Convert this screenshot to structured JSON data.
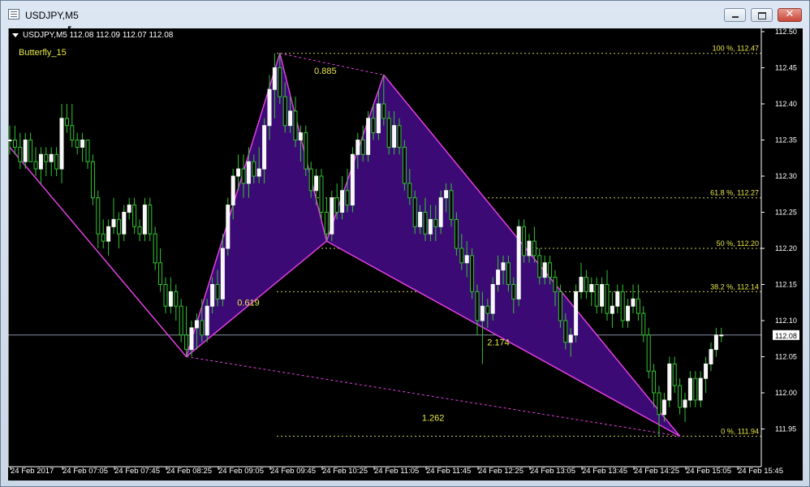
{
  "window": {
    "title": "USDJPY,M5",
    "minimize_label": "",
    "maximize_label": "",
    "close_label": "✕"
  },
  "chart_data": {
    "type": "candlestick",
    "header": "USDJPY,M5  112.08 112.09 112.07 112.08",
    "symbol": "USDJPY,M5",
    "ohlc_header": [
      112.08,
      112.09,
      112.07,
      112.08
    ],
    "indicator_name": "Butterfly_15",
    "current_price": 112.08,
    "current_price_label": "112.08",
    "ylim": [
      111.9,
      112.5
    ],
    "y_ticks": [
      111.95,
      112.0,
      112.05,
      112.1,
      112.15,
      112.2,
      112.25,
      112.3,
      112.35,
      112.4,
      112.45,
      112.5
    ],
    "y_tick_labels": [
      "111.95",
      "112.00",
      "112.05",
      "112.10",
      "112.15",
      "112.20",
      "112.25",
      "112.30",
      "112.35",
      "112.40",
      "112.45",
      "112.50"
    ],
    "x_labels": [
      "24 Feb 2017",
      "24 Feb 07:05",
      "24 Feb 07:45",
      "24 Feb 08:25",
      "24 Feb 09:05",
      "24 Feb 09:45",
      "24 Feb 10:25",
      "24 Feb 11:05",
      "24 Feb 11:45",
      "24 Feb 12:25",
      "24 Feb 13:05",
      "24 Feb 13:45",
      "24 Feb 14:25",
      "24 Feb 15:05",
      "24 Feb 15:45"
    ],
    "pattern": {
      "name": "Butterfly",
      "points": [
        {
          "bar": 0,
          "price": 112.34
        },
        {
          "bar": 34,
          "price": 112.05
        },
        {
          "bar": 52,
          "price": 112.47
        },
        {
          "bar": 61,
          "price": 112.21
        },
        {
          "bar": 72,
          "price": 112.44
        },
        {
          "bar": 129,
          "price": 111.94
        }
      ],
      "ratios": [
        "0.619",
        "0.885",
        "2.174",
        "1.262"
      ]
    },
    "fibonacci": [
      {
        "level": "100 %",
        "price": 112.47,
        "label": "100 %,  112.47"
      },
      {
        "level": "61.8 %",
        "price": 112.27,
        "label": "61.8 %,  112.27"
      },
      {
        "level": "50 %",
        "price": 112.2,
        "label": "50 %,  112.20"
      },
      {
        "level": "38.2 %",
        "price": 112.14,
        "label": "38.2 %,  112.14"
      },
      {
        "level": "0 %",
        "price": 111.94,
        "label": "0 %,  111.94"
      }
    ],
    "candles": [
      [
        112.35,
        112.37,
        112.33,
        112.35
      ],
      [
        112.35,
        112.37,
        112.33,
        112.34
      ],
      [
        112.34,
        112.36,
        112.31,
        112.32
      ],
      [
        112.32,
        112.36,
        112.31,
        112.35
      ],
      [
        112.35,
        112.36,
        112.32,
        112.32
      ],
      [
        112.32,
        112.34,
        112.3,
        112.31
      ],
      [
        112.31,
        112.34,
        112.29,
        112.33
      ],
      [
        112.33,
        112.34,
        112.3,
        112.32
      ],
      [
        112.32,
        112.34,
        112.3,
        112.33
      ],
      [
        112.33,
        112.34,
        112.3,
        112.31
      ],
      [
        112.31,
        112.4,
        112.29,
        112.38
      ],
      [
        112.38,
        112.4,
        112.36,
        112.37
      ],
      [
        112.37,
        112.4,
        112.34,
        112.35
      ],
      [
        112.35,
        112.36,
        112.33,
        112.34
      ],
      [
        112.34,
        112.36,
        112.32,
        112.35
      ],
      [
        112.35,
        112.35,
        112.31,
        112.32
      ],
      [
        112.32,
        112.33,
        112.26,
        112.27
      ],
      [
        112.27,
        112.28,
        112.2,
        112.22
      ],
      [
        112.22,
        112.24,
        112.2,
        112.21
      ],
      [
        112.21,
        112.24,
        112.19,
        112.23
      ],
      [
        112.23,
        112.27,
        112.22,
        112.24
      ],
      [
        112.24,
        112.25,
        112.2,
        112.22
      ],
      [
        112.22,
        112.26,
        112.21,
        112.25
      ],
      [
        112.25,
        112.27,
        112.24,
        112.26
      ],
      [
        112.26,
        112.27,
        112.22,
        112.23
      ],
      [
        112.23,
        112.24,
        112.21,
        112.22
      ],
      [
        112.22,
        112.27,
        112.21,
        112.26
      ],
      [
        112.26,
        112.27,
        112.21,
        112.22
      ],
      [
        112.22,
        112.23,
        112.17,
        112.18
      ],
      [
        112.18,
        112.2,
        112.14,
        112.15
      ],
      [
        112.15,
        112.16,
        112.11,
        112.12
      ],
      [
        112.12,
        112.16,
        112.11,
        112.14
      ],
      [
        112.14,
        112.15,
        112.1,
        112.12
      ],
      [
        112.12,
        112.13,
        112.07,
        112.08
      ],
      [
        112.08,
        112.12,
        112.05,
        112.06
      ],
      [
        112.06,
        112.1,
        112.05,
        112.09
      ],
      [
        112.09,
        112.11,
        112.06,
        112.1
      ],
      [
        112.1,
        112.13,
        112.07,
        112.08
      ],
      [
        112.08,
        112.13,
        112.07,
        112.12
      ],
      [
        112.12,
        112.16,
        112.11,
        112.15
      ],
      [
        112.15,
        112.17,
        112.12,
        112.13
      ],
      [
        112.13,
        112.22,
        112.12,
        112.2
      ],
      [
        112.2,
        112.27,
        112.19,
        112.26
      ],
      [
        112.26,
        112.31,
        112.24,
        112.3
      ],
      [
        112.3,
        112.33,
        112.28,
        112.31
      ],
      [
        112.31,
        112.33,
        112.27,
        112.29
      ],
      [
        112.29,
        112.34,
        112.27,
        112.32
      ],
      [
        112.32,
        112.33,
        112.29,
        112.3
      ],
      [
        112.3,
        112.34,
        112.29,
        112.31
      ],
      [
        112.31,
        112.38,
        112.29,
        112.37
      ],
      [
        112.37,
        112.44,
        112.35,
        112.42
      ],
      [
        112.42,
        112.47,
        112.38,
        112.45
      ],
      [
        112.45,
        112.47,
        112.4,
        112.41
      ],
      [
        112.41,
        112.43,
        112.36,
        112.37
      ],
      [
        112.37,
        112.41,
        112.36,
        112.39
      ],
      [
        112.39,
        112.41,
        112.34,
        112.35
      ],
      [
        112.35,
        112.37,
        112.32,
        112.36
      ],
      [
        112.36,
        112.37,
        112.3,
        112.31
      ],
      [
        112.31,
        112.32,
        112.27,
        112.28
      ],
      [
        112.28,
        112.31,
        112.26,
        112.3
      ],
      [
        112.3,
        112.31,
        112.24,
        112.25
      ],
      [
        112.25,
        112.27,
        112.21,
        112.22
      ],
      [
        112.22,
        112.28,
        112.21,
        112.27
      ],
      [
        112.27,
        112.29,
        112.24,
        112.25
      ],
      [
        112.25,
        112.3,
        112.24,
        112.28
      ],
      [
        112.28,
        112.31,
        112.25,
        112.26
      ],
      [
        112.26,
        112.34,
        112.25,
        112.33
      ],
      [
        112.33,
        112.36,
        112.31,
        112.35
      ],
      [
        112.35,
        112.37,
        112.32,
        112.33
      ],
      [
        112.33,
        112.39,
        112.32,
        112.38
      ],
      [
        112.38,
        112.4,
        112.35,
        112.36
      ],
      [
        112.36,
        112.42,
        112.35,
        112.4
      ],
      [
        112.4,
        112.44,
        112.37,
        112.38
      ],
      [
        112.38,
        112.39,
        112.33,
        112.34
      ],
      [
        112.34,
        112.39,
        112.33,
        112.37
      ],
      [
        112.37,
        112.38,
        112.33,
        112.34
      ],
      [
        112.34,
        112.35,
        112.28,
        112.29
      ],
      [
        112.29,
        112.31,
        112.26,
        112.27
      ],
      [
        112.27,
        112.28,
        112.22,
        112.23
      ],
      [
        112.23,
        112.26,
        112.22,
        112.25
      ],
      [
        112.25,
        112.27,
        112.21,
        112.22
      ],
      [
        112.22,
        112.26,
        112.21,
        112.24
      ],
      [
        112.24,
        112.26,
        112.21,
        112.23
      ],
      [
        112.23,
        112.28,
        112.22,
        112.27
      ],
      [
        112.27,
        112.29,
        112.25,
        112.28
      ],
      [
        112.28,
        112.29,
        112.23,
        112.24
      ],
      [
        112.24,
        112.25,
        112.19,
        112.2
      ],
      [
        112.2,
        112.22,
        112.17,
        112.18
      ],
      [
        112.18,
        112.21,
        112.16,
        112.19
      ],
      [
        112.19,
        112.2,
        112.13,
        112.14
      ],
      [
        112.14,
        112.15,
        112.08,
        112.1
      ],
      [
        112.1,
        112.14,
        112.04,
        112.12
      ],
      [
        112.12,
        112.13,
        112.09,
        112.11
      ],
      [
        112.11,
        112.16,
        112.1,
        112.15
      ],
      [
        112.15,
        112.19,
        112.14,
        112.17
      ],
      [
        112.17,
        112.19,
        112.15,
        112.18
      ],
      [
        112.18,
        112.19,
        112.14,
        112.15
      ],
      [
        112.15,
        112.16,
        112.11,
        112.13
      ],
      [
        112.13,
        112.24,
        112.12,
        112.23
      ],
      [
        112.23,
        112.24,
        112.18,
        112.19
      ],
      [
        112.19,
        112.22,
        112.18,
        112.21
      ],
      [
        112.21,
        112.23,
        112.18,
        112.19
      ],
      [
        112.19,
        112.2,
        112.15,
        112.16
      ],
      [
        112.16,
        112.19,
        112.15,
        112.18
      ],
      [
        112.18,
        112.19,
        112.15,
        112.16
      ],
      [
        112.16,
        112.17,
        112.12,
        112.14
      ],
      [
        112.14,
        112.15,
        112.09,
        112.1
      ],
      [
        112.1,
        112.11,
        112.06,
        112.07
      ],
      [
        112.07,
        112.09,
        112.05,
        112.08
      ],
      [
        112.08,
        112.15,
        112.07,
        112.14
      ],
      [
        112.14,
        112.18,
        112.13,
        112.16
      ],
      [
        112.16,
        112.17,
        112.13,
        112.14
      ],
      [
        112.14,
        112.16,
        112.12,
        112.15
      ],
      [
        112.15,
        112.16,
        112.11,
        112.12
      ],
      [
        112.12,
        112.16,
        112.11,
        112.15
      ],
      [
        112.15,
        112.17,
        112.1,
        112.11
      ],
      [
        112.11,
        112.14,
        112.09,
        112.12
      ],
      [
        112.12,
        112.15,
        112.11,
        112.14
      ],
      [
        112.14,
        112.15,
        112.09,
        112.1
      ],
      [
        112.1,
        112.13,
        112.09,
        112.12
      ],
      [
        112.12,
        112.15,
        112.11,
        112.13
      ],
      [
        112.13,
        112.15,
        112.1,
        112.11
      ],
      [
        112.11,
        112.12,
        112.07,
        112.08
      ],
      [
        112.08,
        112.09,
        112.02,
        112.03
      ],
      [
        112.03,
        112.04,
        111.98,
        112.0
      ],
      [
        112.0,
        112.01,
        111.94,
        111.97
      ],
      [
        111.97,
        112.0,
        111.96,
        111.99
      ],
      [
        111.99,
        112.05,
        111.98,
        112.04
      ],
      [
        112.04,
        112.05,
        112.0,
        112.01
      ],
      [
        112.01,
        112.02,
        111.97,
        111.98
      ],
      [
        111.98,
        112.0,
        111.96,
        111.99
      ],
      [
        111.99,
        112.03,
        111.98,
        112.02
      ],
      [
        112.02,
        112.03,
        111.98,
        111.99
      ],
      [
        111.99,
        112.03,
        111.98,
        112.02
      ],
      [
        112.02,
        112.05,
        112.0,
        112.04
      ],
      [
        112.04,
        112.07,
        112.03,
        112.06
      ],
      [
        112.06,
        112.09,
        112.05,
        112.08
      ],
      [
        112.08,
        112.09,
        112.07,
        112.08
      ]
    ]
  }
}
